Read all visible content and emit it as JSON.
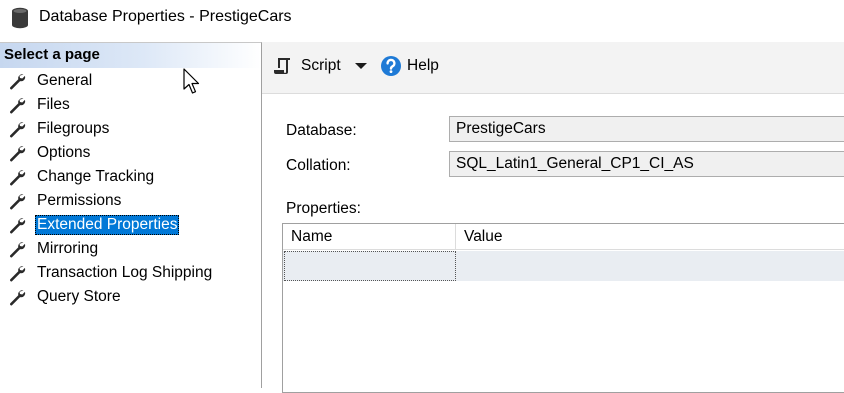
{
  "window": {
    "title": "Database Properties - PrestigeCars",
    "icon": "database-icon"
  },
  "sidebar": {
    "header": "Select a page",
    "selected_index": 6,
    "items": [
      {
        "label": "General",
        "icon": "wrench-icon"
      },
      {
        "label": "Files",
        "icon": "wrench-icon"
      },
      {
        "label": "Filegroups",
        "icon": "wrench-icon"
      },
      {
        "label": "Options",
        "icon": "wrench-icon"
      },
      {
        "label": "Change Tracking",
        "icon": "wrench-icon"
      },
      {
        "label": "Permissions",
        "icon": "wrench-icon"
      },
      {
        "label": "Extended Properties",
        "icon": "wrench-icon"
      },
      {
        "label": "Mirroring",
        "icon": "wrench-icon"
      },
      {
        "label": "Transaction Log Shipping",
        "icon": "wrench-icon"
      },
      {
        "label": "Query Store",
        "icon": "wrench-icon"
      }
    ]
  },
  "toolbar": {
    "script_label": "Script",
    "script_icon": "script-icon",
    "dropdown_icon": "dropdown-arrow-icon",
    "help_label": "Help",
    "help_icon": "help-icon"
  },
  "form": {
    "database_label": "Database:",
    "database_value": "PrestigeCars",
    "collation_label": "Collation:",
    "collation_value": "SQL_Latin1_General_CP1_CI_AS",
    "properties_label": "Properties:"
  },
  "grid": {
    "columns": [
      "Name",
      "Value"
    ],
    "rows": [
      {
        "name": "",
        "value": ""
      }
    ]
  },
  "colors": {
    "selection": "#0078d7",
    "header_gradient_start": "#c6d7ef",
    "toolbar_bg": "#f3f3f3",
    "help_icon_blue": "#1e7ad6"
  }
}
